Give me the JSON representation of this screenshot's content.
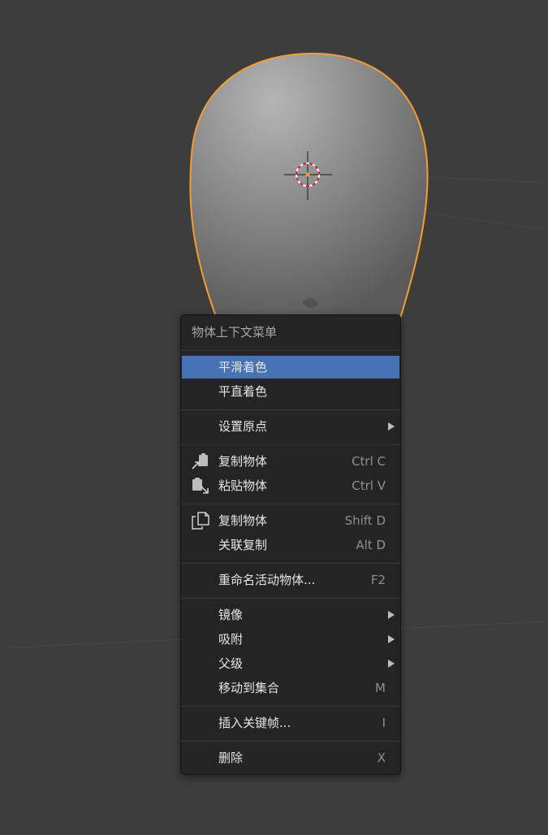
{
  "menu": {
    "title": "物体上下文菜单",
    "items": [
      {
        "label": "平滑着色"
      },
      {
        "label": "平直着色"
      },
      {
        "label": "设置原点"
      },
      {
        "label": "复制物体",
        "shortcut": "Ctrl C",
        "icon": "copy-icon"
      },
      {
        "label": "粘贴物体",
        "shortcut": "Ctrl V",
        "icon": "paste-icon"
      },
      {
        "label": "复制物体",
        "shortcut": "Shift D",
        "icon": "duplicate-icon"
      },
      {
        "label": "关联复制",
        "shortcut": "Alt D"
      },
      {
        "label": "重命名活动物体...",
        "shortcut": "F2"
      },
      {
        "label": "镜像"
      },
      {
        "label": "吸附"
      },
      {
        "label": "父级"
      },
      {
        "label": "移动到集合",
        "shortcut": "M"
      },
      {
        "label": "插入关键帧...",
        "shortcut": "I"
      },
      {
        "label": "删除",
        "shortcut": "X"
      }
    ]
  },
  "colors": {
    "viewport_bg": "#3d3d3d",
    "menu_bg": "#242424",
    "highlight": "#4772b3",
    "selection_outline": "#f39c2f"
  }
}
